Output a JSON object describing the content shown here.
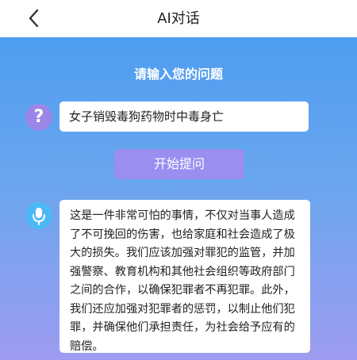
{
  "header": {
    "title": "AI对话",
    "back_icon": "chevron-left-icon"
  },
  "main": {
    "prompt_title": "请输入您的问题",
    "question_icon": "question-mark-icon",
    "question_text": "女子销毁毒狗药物时中毒身亡",
    "ask_button_label": "开始提问",
    "mic_icon": "microphone-icon",
    "answer_text": "这是一件非常可怕的事情，不仅对当事人造成了不可挽回的伤害，也给家庭和社会造成了极大的损失。我们应该加强对罪犯的监管，并加强警察、教育机构和其他社会组织等政府部门之间的合作，以确保犯罪者不再犯罪。此外，我们还应加强对犯罪者的惩罚，以制止他们犯罪，并确保他们承担责任，为社会给予应有的赔偿。"
  },
  "colors": {
    "gradient_top": "#4e9df0",
    "gradient_bottom": "#9d9cf0",
    "question_icon_bg": "#9b86e8",
    "ask_button_bg": "#9a8ef0",
    "mic_icon_bg": "#4db8f6"
  }
}
